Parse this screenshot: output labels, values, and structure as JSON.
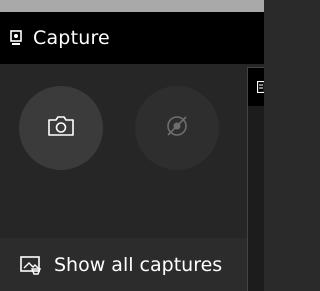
{
  "widget": {
    "title": "Capture",
    "header_icon": "capture-widget-icon"
  },
  "buttons": {
    "screenshot": {
      "icon": "camera-icon",
      "enabled": true
    },
    "record": {
      "icon": "record-disabled-icon",
      "enabled": false
    }
  },
  "footer": {
    "label": "Show all captures",
    "icon": "gallery-icon"
  },
  "side_panel": {
    "icon": "widget-icon"
  },
  "colors": {
    "header_bg": "#000000",
    "body_bg": "#262626",
    "active_button": "#3b3b3b",
    "disabled_button": "#2e2e2e",
    "footer_bg": "#2c2c2c",
    "text": "#ffffff"
  }
}
